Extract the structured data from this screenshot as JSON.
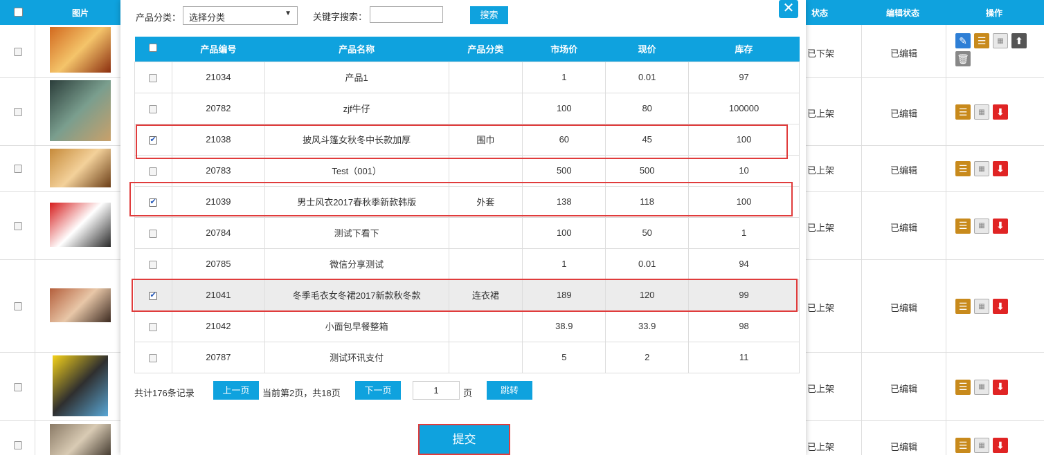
{
  "background": {
    "header": {
      "checkbox_col": "",
      "image_col": "图片",
      "status_col": "状态",
      "edit_status_col": "编辑状态",
      "ops_col": "操作"
    },
    "rows": [
      {
        "status": "已下架",
        "edit_status": "已编辑"
      },
      {
        "status": "已上架",
        "edit_status": "已编辑"
      },
      {
        "status": "已上架",
        "edit_status": "已编辑"
      },
      {
        "status": "已上架",
        "edit_status": "已编辑"
      },
      {
        "status": "已上架",
        "edit_status": "已编辑"
      },
      {
        "status": "已上架",
        "edit_status": "已编辑"
      },
      {
        "status": "已上架",
        "edit_status": "已编辑"
      }
    ]
  },
  "modal": {
    "filter": {
      "category_label": "产品分类：",
      "category_value": "选择分类",
      "keyword_label": "关键字搜索：",
      "keyword_value": "",
      "search_button": "搜索"
    },
    "columns": [
      "产品编号",
      "产品名称",
      "产品分类",
      "市场价",
      "现价",
      "库存"
    ],
    "rows": [
      {
        "checked": false,
        "id": "21034",
        "name": "产品1",
        "category": "",
        "market_price": "1",
        "price": "0.01",
        "stock": "97"
      },
      {
        "checked": false,
        "id": "20782",
        "name": "zjf牛仔",
        "category": "",
        "market_price": "100",
        "price": "80",
        "stock": "100000"
      },
      {
        "checked": true,
        "id": "21038",
        "name": "披风斗篷女秋冬中长款加厚",
        "category": "围巾",
        "market_price": "60",
        "price": "45",
        "stock": "100"
      },
      {
        "checked": false,
        "id": "20783",
        "name": "Test（001）",
        "category": "",
        "market_price": "500",
        "price": "500",
        "stock": "10"
      },
      {
        "checked": true,
        "id": "21039",
        "name": "男士风衣2017春秋季新款韩版",
        "category": "外套",
        "market_price": "138",
        "price": "118",
        "stock": "100"
      },
      {
        "checked": false,
        "id": "20784",
        "name": "测试下看下",
        "category": "",
        "market_price": "100",
        "price": "50",
        "stock": "1"
      },
      {
        "checked": false,
        "id": "20785",
        "name": "微信分享测试",
        "category": "",
        "market_price": "1",
        "price": "0.01",
        "stock": "94"
      },
      {
        "checked": true,
        "id": "21041",
        "name": "冬季毛衣女冬裙2017新款秋冬款",
        "category": "连衣裙",
        "market_price": "189",
        "price": "120",
        "stock": "99"
      },
      {
        "checked": false,
        "id": "21042",
        "name": "小面包早餐整箱",
        "category": "",
        "market_price": "38.9",
        "price": "33.9",
        "stock": "98"
      },
      {
        "checked": false,
        "id": "20787",
        "name": "测试环讯支付",
        "category": "",
        "market_price": "5",
        "price": "2",
        "stock": "11"
      }
    ],
    "pager": {
      "total": "共计176条记录",
      "prev": "上一页",
      "info": "当前第2页，共18页",
      "next": "下一页",
      "page_value": "1",
      "page_unit": "页",
      "jump": "跳转"
    },
    "submit": "提交",
    "close_icon": "close-icon"
  },
  "colors": {
    "accent": "#0fa2de",
    "highlight": "#e03c3c"
  }
}
